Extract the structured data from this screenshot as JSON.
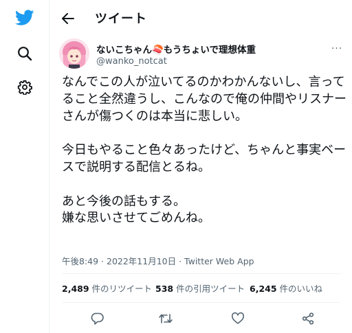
{
  "nav": {
    "logo_icon": "twitter-bird-icon",
    "explore_icon": "search-icon",
    "settings_icon": "gear-icon",
    "brand_color": "#1d9bf0"
  },
  "header": {
    "title": "ツイート",
    "back_icon": "arrow-left-icon"
  },
  "author": {
    "display_name": "ないこちゃん🍣もうちょいで理想体重",
    "username": "@wanko_notcat",
    "more_label": "···"
  },
  "tweet": {
    "text": "なんでこの人が泣いてるのかわかんないし、言ってること全然違うし、こんなので俺の仲間やリスナーさんが傷つくのは本当に悲しい。\n\n今日もやること色々あったけど、ちゃんと事実ベースで説明する配信とるね。\n\nあと今後の話もする。\n嫌な思いさせてごめんね。",
    "time": "午後8:49",
    "separator": " · ",
    "date": "2022年11月10日",
    "source": "Twitter Web App"
  },
  "stats": {
    "retweets_count": "2,489",
    "retweets_label": " 件のリツイート",
    "quotes_count": "538",
    "quotes_label": " 件の引用ツイート",
    "likes_count": "6,245",
    "likes_label": " 件のいいね"
  },
  "actions": {
    "reply_icon": "reply-icon",
    "retweet_icon": "retweet-icon",
    "like_icon": "heart-icon",
    "share_icon": "share-icon"
  }
}
